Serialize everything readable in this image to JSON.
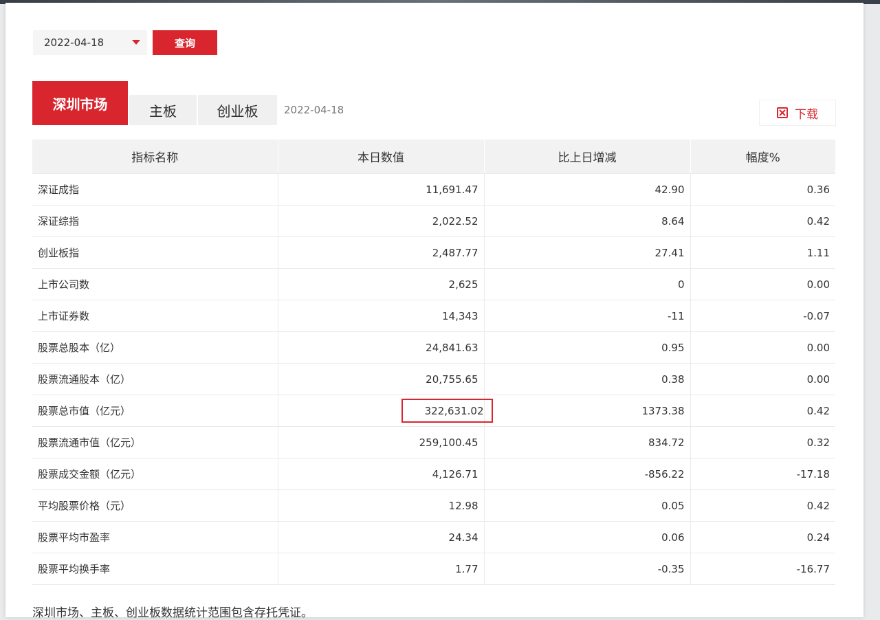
{
  "query": {
    "date_value": "2022-04-18",
    "query_label": "查询"
  },
  "tabs": [
    {
      "label": "深圳市场",
      "active": true
    },
    {
      "label": "主板",
      "active": false
    },
    {
      "label": "创业板",
      "active": false
    }
  ],
  "tab_date": "2022-04-18",
  "download_label": "下载",
  "table": {
    "headers": [
      "指标名称",
      "本日数值",
      "比上日增减",
      "幅度%"
    ],
    "rows": [
      [
        "深证成指",
        "11,691.47",
        "42.90",
        "0.36"
      ],
      [
        "深证综指",
        "2,022.52",
        "8.64",
        "0.42"
      ],
      [
        "创业板指",
        "2,487.77",
        "27.41",
        "1.11"
      ],
      [
        "上市公司数",
        "2,625",
        "0",
        "0.00"
      ],
      [
        "上市证券数",
        "14,343",
        "-11",
        "-0.07"
      ],
      [
        "股票总股本（亿）",
        "24,841.63",
        "0.95",
        "0.00"
      ],
      [
        "股票流通股本（亿）",
        "20,755.65",
        "0.38",
        "0.00"
      ],
      [
        "股票总市值（亿元）",
        "322,631.02",
        "1373.38",
        "0.42"
      ],
      [
        "股票流通市值（亿元）",
        "259,100.45",
        "834.72",
        "0.32"
      ],
      [
        "股票成交金额（亿元）",
        "4,126.71",
        "-856.22",
        "-17.18"
      ],
      [
        "平均股票价格（元）",
        "12.98",
        "0.05",
        "0.42"
      ],
      [
        "股票平均市盈率",
        "24.34",
        "0.06",
        "0.24"
      ],
      [
        "股票平均换手率",
        "1.77",
        "-0.35",
        "-16.77"
      ]
    ]
  },
  "footnote": "深圳市场、主板、创业板数据统计范围包含存托凭证。",
  "colors": {
    "accent": "#d9262e",
    "header_bg": "#f2f2f2"
  }
}
